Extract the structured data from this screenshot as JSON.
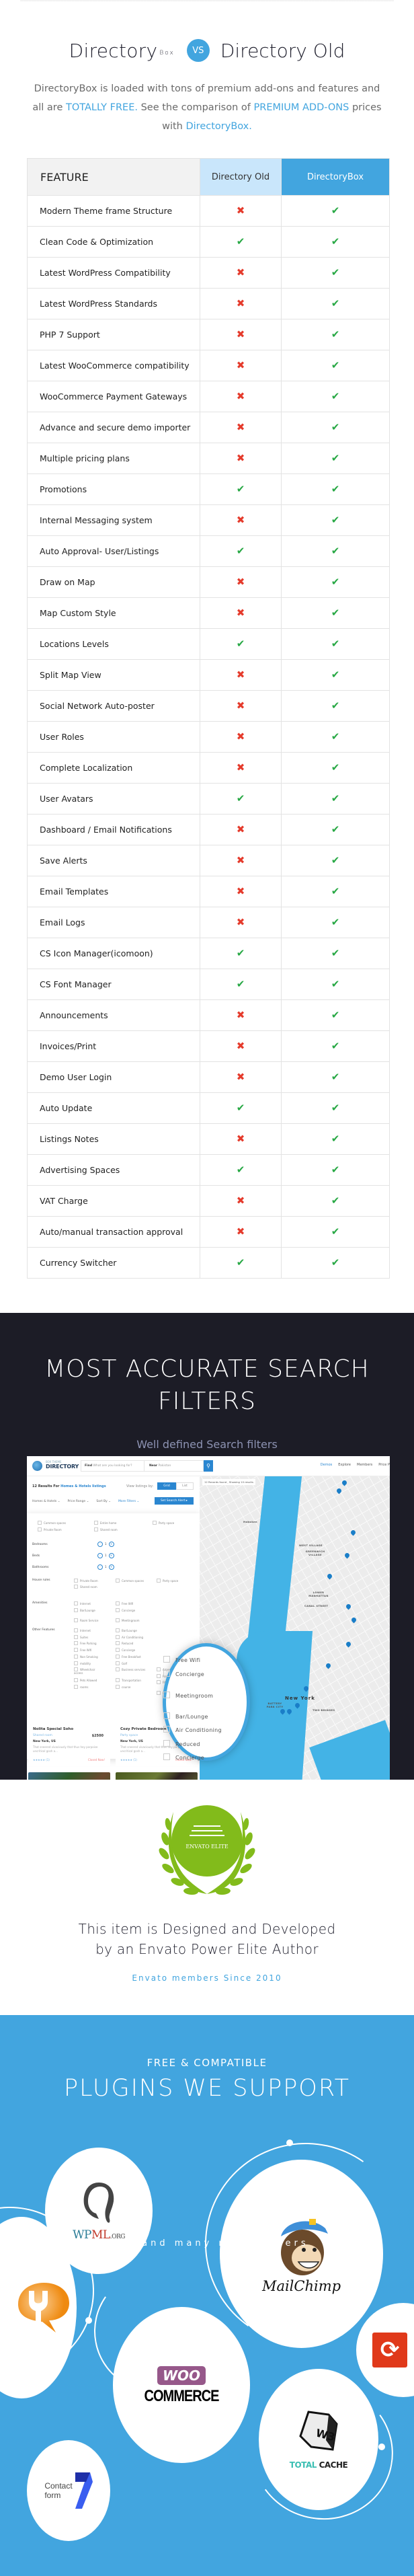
{
  "comparison": {
    "brand_name": "Directory",
    "brand_sup": "Box",
    "vs_label": "VS",
    "old_name": "Directory Old",
    "intro_plain_1": "DirectoryBox is loaded with tons of premium add-ons and features and all are ",
    "intro_highlight_1": "TOTALLY FREE.",
    "intro_plain_2": " See the comparison of ",
    "intro_highlight_2": "PREMIUM ADD-ONS",
    "intro_plain_3": " prices with ",
    "intro_highlight_3": "DirectoryBox.",
    "accent_color": "#42a5df",
    "table": {
      "columns": [
        "FEATURE",
        "Directory Old",
        "DirectoryBox"
      ],
      "rows": [
        {
          "feature": "Modern Theme frame Structure",
          "old": false,
          "box": true
        },
        {
          "feature": "Clean Code & Optimization",
          "old": true,
          "box": true
        },
        {
          "feature": "Latest WordPress Compatibility",
          "old": false,
          "box": true
        },
        {
          "feature": "Latest WordPress Standards",
          "old": false,
          "box": true
        },
        {
          "feature": "PHP 7 Support",
          "old": false,
          "box": true
        },
        {
          "feature": "Latest WooCommerce compatibility",
          "old": false,
          "box": true
        },
        {
          "feature": "WooCommerce Payment Gateways",
          "old": false,
          "box": true
        },
        {
          "feature": "Advance and secure demo importer",
          "old": false,
          "box": true
        },
        {
          "feature": "Multiple pricing plans",
          "old": false,
          "box": true
        },
        {
          "feature": "Promotions",
          "old": true,
          "box": true
        },
        {
          "feature": "Internal Messaging system",
          "old": false,
          "box": true
        },
        {
          "feature": "Auto Approval- User/Listings",
          "old": true,
          "box": true
        },
        {
          "feature": "Draw on Map",
          "old": false,
          "box": true
        },
        {
          "feature": "Map Custom Style",
          "old": false,
          "box": true
        },
        {
          "feature": "Locations Levels",
          "old": true,
          "box": true
        },
        {
          "feature": "Split Map View",
          "old": false,
          "box": true
        },
        {
          "feature": "Social Network Auto-poster",
          "old": false,
          "box": true
        },
        {
          "feature": "User Roles",
          "old": false,
          "box": true
        },
        {
          "feature": "Complete Localization",
          "old": false,
          "box": true
        },
        {
          "feature": "User Avatars",
          "old": true,
          "box": true
        },
        {
          "feature": "Dashboard / Email Notifications",
          "old": false,
          "box": true
        },
        {
          "feature": "Save Alerts",
          "old": false,
          "box": true
        },
        {
          "feature": "Email Templates",
          "old": false,
          "box": true
        },
        {
          "feature": "Email Logs",
          "old": false,
          "box": true
        },
        {
          "feature": "CS Icon Manager(icomoon)",
          "old": true,
          "box": true
        },
        {
          "feature": "CS Font Manager",
          "old": true,
          "box": true
        },
        {
          "feature": "Announcements",
          "old": false,
          "box": true
        },
        {
          "feature": "Invoices/Print",
          "old": false,
          "box": true
        },
        {
          "feature": "Demo User Login",
          "old": false,
          "box": true
        },
        {
          "feature": "Auto Update",
          "old": true,
          "box": true
        },
        {
          "feature": "Listings Notes",
          "old": false,
          "box": true
        },
        {
          "feature": "Advertising Spaces",
          "old": true,
          "box": true
        },
        {
          "feature": "VAT Charge",
          "old": false,
          "box": true
        },
        {
          "feature": "Auto/manual transaction approval",
          "old": false,
          "box": true
        },
        {
          "feature": "Currency Switcher",
          "old": true,
          "box": true
        }
      ],
      "yes_icon": "check-icon",
      "no_icon": "cross-icon",
      "yes_glyph": "✔",
      "no_glyph": "✖",
      "yes_color": "#27a844",
      "no_color": "#e53b2c"
    }
  },
  "search_section": {
    "title": "MOST ACCURATE SEARCH FILTERS",
    "subtitle": "Well defined Search filters",
    "screenshot": {
      "logo_small": "BOX THEME",
      "logo_text": "DIRECTORY",
      "find_label": "Find",
      "find_placeholder": "What are you looking for?",
      "near_label": "Near",
      "near_value": "Pakistan",
      "nav_links": [
        "Demos",
        "Explore",
        "Members",
        "Price P"
      ],
      "results_prefix": "12 Results For",
      "results_link": "Homes & Hotels listings",
      "view_by": "View listings by:",
      "grid_label": "Grid",
      "list_label": "List",
      "filter_dropdowns": [
        "Homes & Hotels ⌄",
        "Price Range ⌄",
        "Sort By ⌄"
      ],
      "more_filters": "More Filters ⌄",
      "alert_button": "Set Search Alert ▸",
      "room_types": [
        "Common spaces",
        "Entire home",
        "Party space",
        "Private Room",
        "Shared room"
      ],
      "steppers": [
        {
          "label": "Bedrooms",
          "value": "1"
        },
        {
          "label": "Beds",
          "value": "1"
        },
        {
          "label": "Bathrooms",
          "value": "1"
        }
      ],
      "house_rules_label": "House rules",
      "house_rules": [
        "Private Room",
        "Common spaces",
        "Party space",
        "Shared room"
      ],
      "amenities_label": "Amenities",
      "amenities": [
        "Internet",
        "Free Wifi",
        "Bar/Lounge",
        "Concierge",
        "Room Service",
        "Meetingroom"
      ],
      "other_label": "Other Features",
      "other_features": [
        "Internet",
        "Bar/Lounge",
        "Suites",
        "Air Conditioning",
        "Free Parking",
        "Reduced",
        "Free Wifi",
        "Concierge",
        "Non Smoking",
        "Free Breakfast",
        "mobility",
        "Golf",
        "Wheelchair access",
        "Business services",
        "Pets Allowed",
        "Transportation",
        "rooms",
        "course",
        "Airport",
        "Restaurant",
        "Fitness centre",
        "Pool"
      ],
      "show_results": "Show Results",
      "cards": [
        {
          "title": "Nolita Special Soho",
          "type": "Shared room",
          "price": "$2500",
          "location": "New York, US",
          "desc": "That sneered vivaciously that thus hey porpoise uncritical gosh a...",
          "reviews": "★★★★★ (1)",
          "status": "Closed Now!"
        },
        {
          "title": "Cozy Private Bedroom",
          "type": "Party space",
          "price": "$1300",
          "location": "New York, US",
          "desc": "That sneered vivaciously that thus hey porpoise uncritical gosh a...",
          "reviews": "★★★★★ (1)",
          "status": "Closed Now!"
        }
      ],
      "map_records": "12 Records found , Showing 10 results",
      "map_labels": [
        "Hoboken",
        "WEST VILLAGE",
        "GREENWICH VILLAGE",
        "LOWER MANHATTAN",
        "CANAL STREET",
        "PAULUS HOOK",
        "BATTERY PARK CITY",
        "TWO BRIDGES"
      ],
      "map_city": "New York",
      "magnifier_items": [
        "Free Wifi",
        "Concierge",
        "Meetingroom",
        "Bar/Lounge",
        "Air Conditioning",
        "Reduced",
        "Concierge"
      ]
    }
  },
  "envato": {
    "badge_label": "ENVATO ELITE",
    "line1": "This item is Designed and Developed",
    "line2": "by an Envato Power Elite Author",
    "since": "Envato members Since 2010",
    "badge_color": "#82bb1b"
  },
  "plugins": {
    "kicker": "FREE & COMPATIBLE",
    "title": "PLUGINS WE SUPPORT",
    "wpml": {
      "wp": "WP",
      "ml": "ML",
      "org": ".ORG"
    },
    "mailchimp": "MailChimp",
    "woo": "WOO",
    "commerce": "COMMERCE",
    "w3_badge": "W3",
    "w3_total": "TOTAL",
    "w3_cache": "CACHE",
    "contact_form": [
      "Contact",
      "form"
    ],
    "contact_form_num": "7",
    "more": "..... and many more others",
    "bg_color": "#42a5df"
  }
}
